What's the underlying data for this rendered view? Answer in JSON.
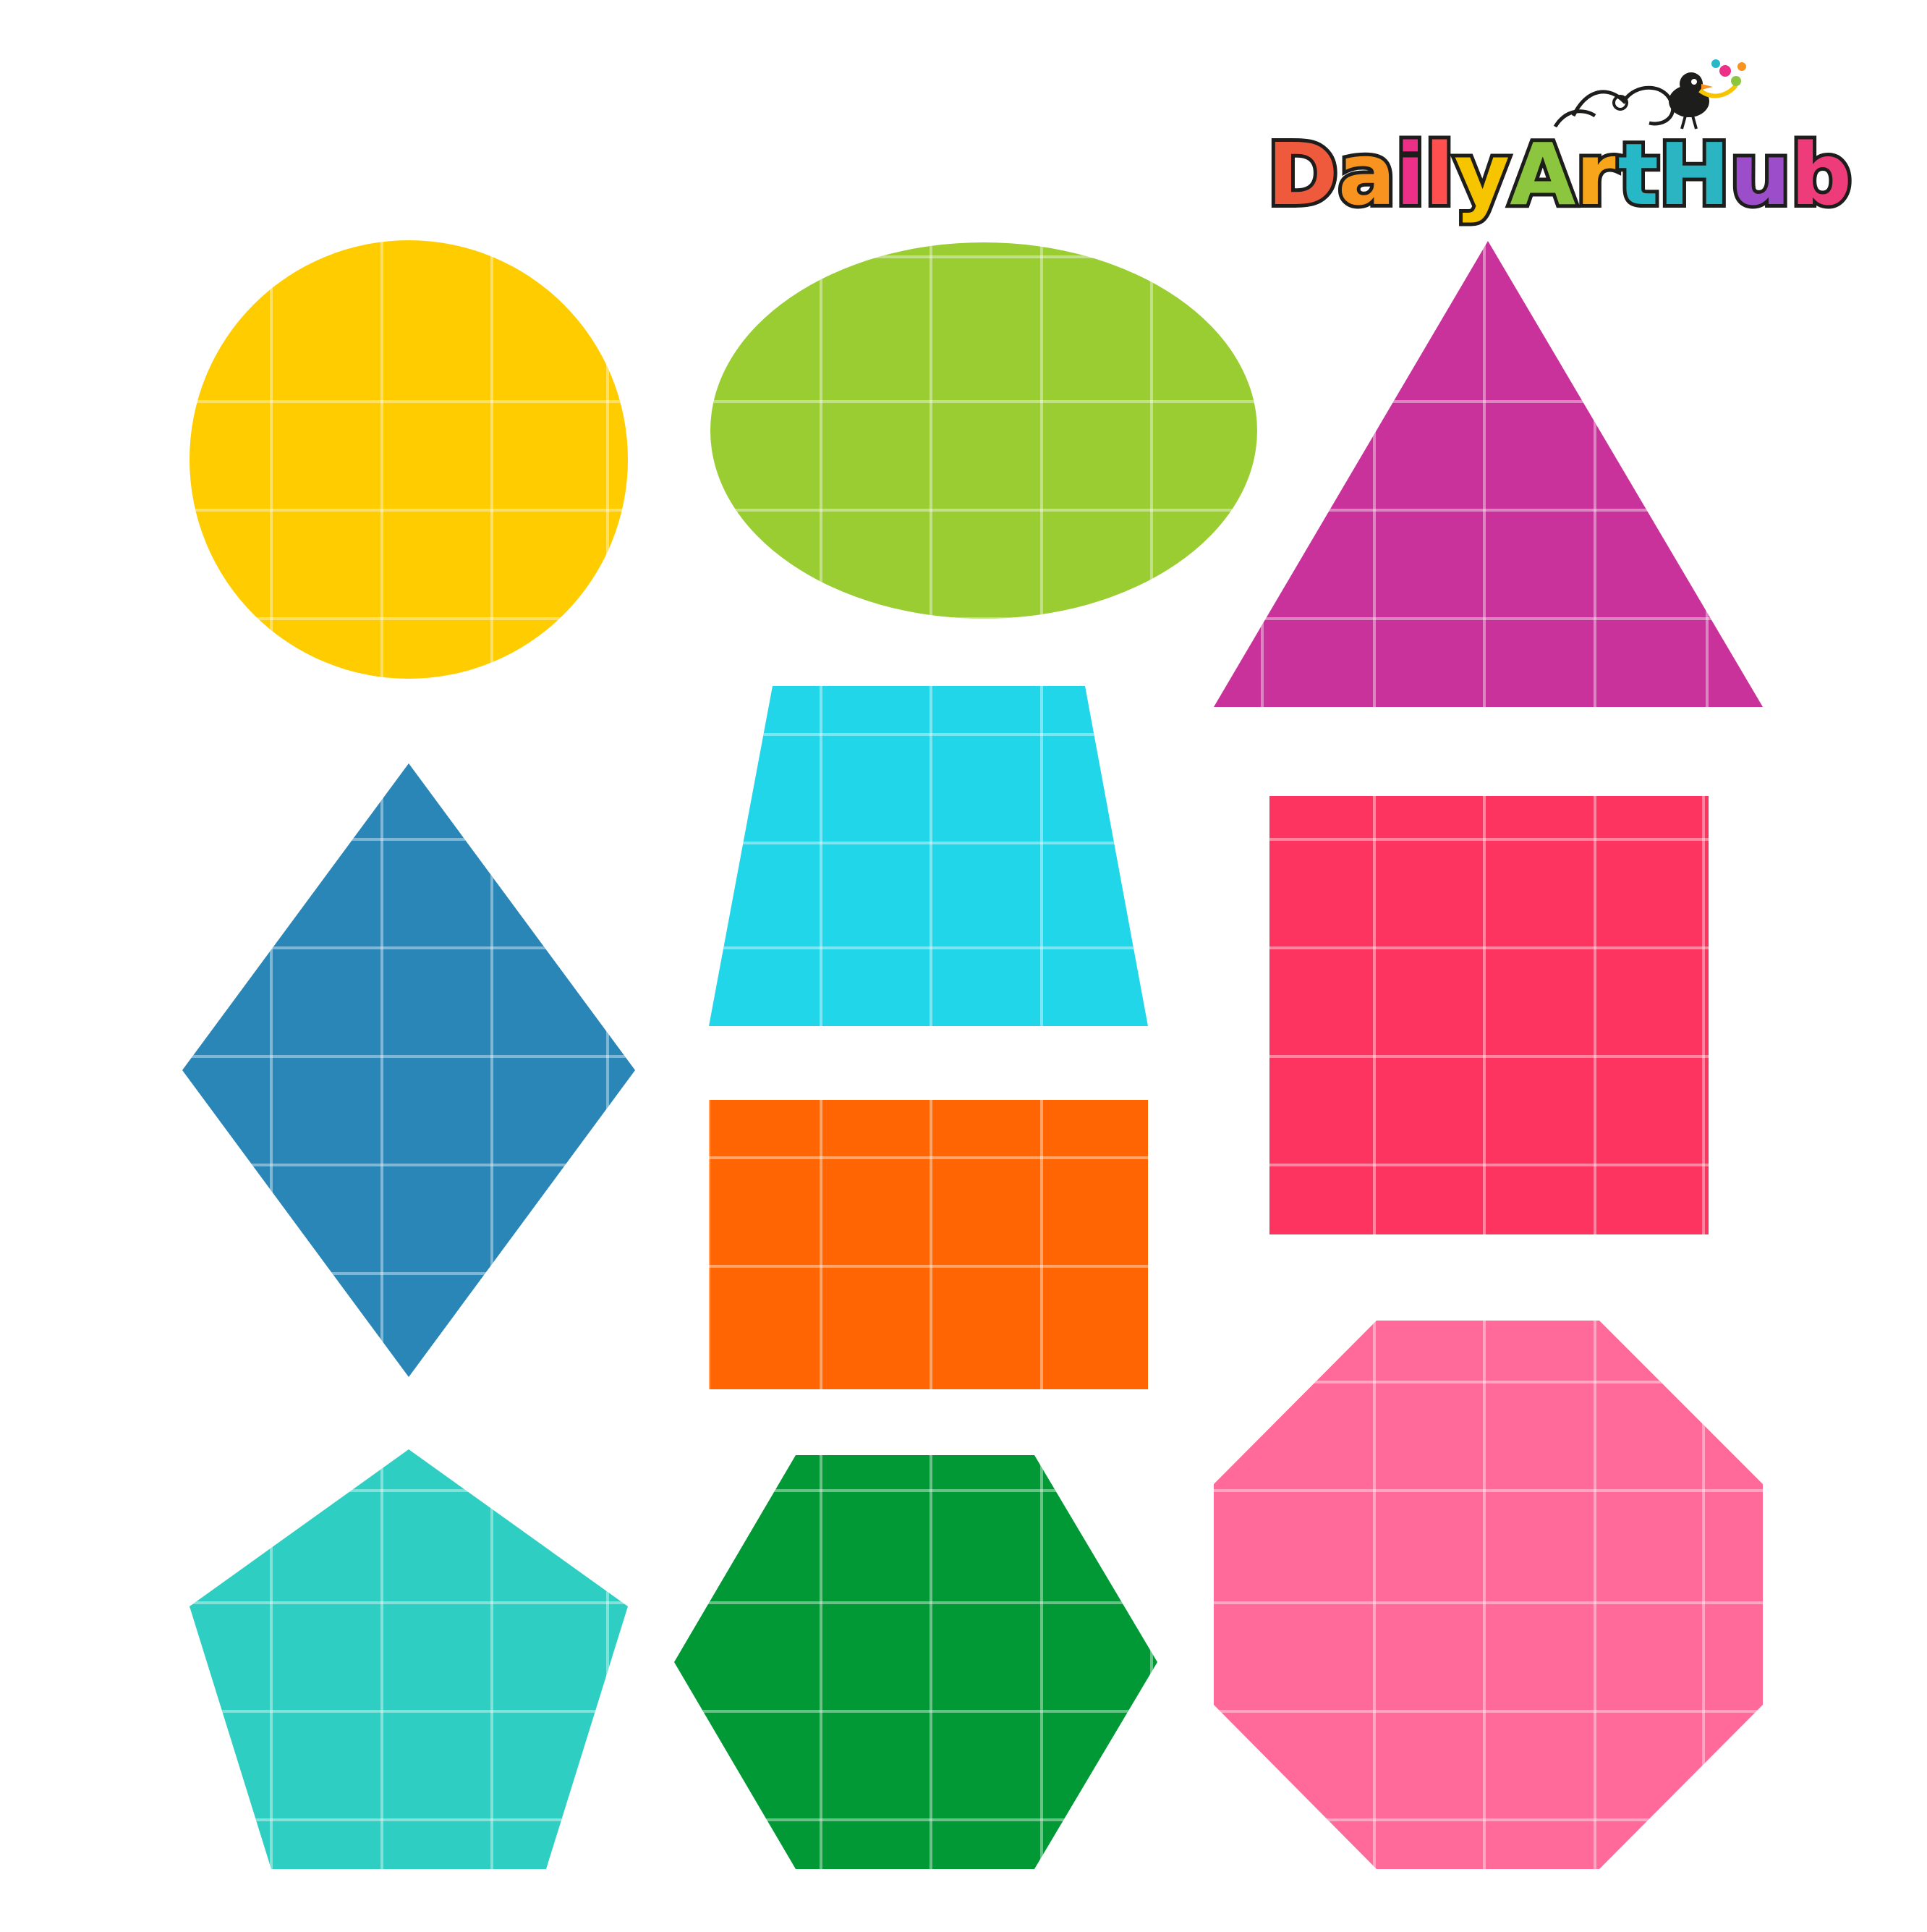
{
  "logo": {
    "text": "DailyArtHub",
    "letter_colors": [
      "#f05a3c",
      "#f7931e",
      "#ec2f87",
      "#ff4f4f",
      "#f7c400",
      "#8cc63f",
      "#f7a61b",
      "#27b8c8",
      "#2bb5c2",
      "#9b4dca",
      "#ee3b7a"
    ],
    "outline_color": "#1d1d1b"
  },
  "shapes": [
    {
      "name": "circle",
      "color": "#ffcc00"
    },
    {
      "name": "oval",
      "color": "#9acd32"
    },
    {
      "name": "triangle",
      "color": "#c9329b"
    },
    {
      "name": "rhombus",
      "color": "#2a86b7"
    },
    {
      "name": "trapezoid",
      "color": "#22d6ea"
    },
    {
      "name": "square",
      "color": "#fc345f"
    },
    {
      "name": "rectangle",
      "color": "#ff6603"
    },
    {
      "name": "pentagon",
      "color": "#2ecfc2"
    },
    {
      "name": "hexagon",
      "color": "#009935"
    },
    {
      "name": "octagon",
      "color": "#ff6a9a"
    }
  ],
  "grid_line_color": "#ffffff"
}
